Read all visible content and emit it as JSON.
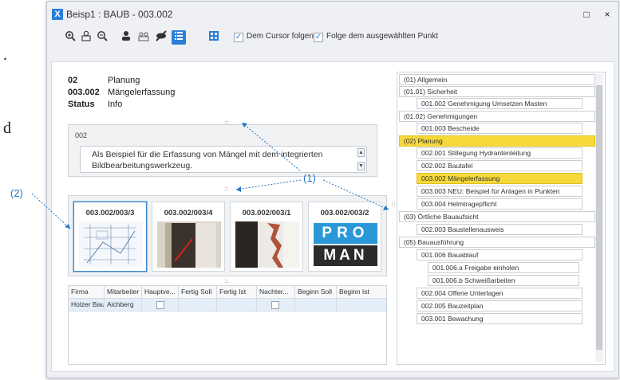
{
  "background": {
    "left_fragment_1": ".",
    "left_fragment_2": "d"
  },
  "window": {
    "icon_letter": "X",
    "title": "Beisp1 : BAUB - 003.002",
    "maximize_glyph": "□",
    "close_glyph": "×"
  },
  "toolbar": {
    "follow_cursor_label": "Dem Cursor folgen",
    "follow_point_label": "Folge dem ausgewählten Punkt"
  },
  "header": {
    "rows": [
      {
        "key": "02",
        "value": "Planung"
      },
      {
        "key": "003.002",
        "value": "Mängelerfassung"
      },
      {
        "key": "Status",
        "value": "Info"
      }
    ]
  },
  "memo": {
    "label": "002",
    "text": "Als Beispiel für die Erfassung von Mängel mit dem integrierten Bildbearbeitungswerkzeug."
  },
  "thumbnails": [
    {
      "label": "003.002/003/3",
      "kind": "sketch"
    },
    {
      "label": "003.002/003/4",
      "kind": "photo-door"
    },
    {
      "label": "003.002/003/1",
      "kind": "photo-wall"
    },
    {
      "label": "003.002/003/2",
      "kind": "logo",
      "logo_top": "PRO",
      "logo_bottom": "MAN"
    }
  ],
  "grid": {
    "columns": [
      "Firma",
      "Mitarbeiter",
      "Hauptve...",
      "Fertig Soll",
      "Fertig Ist",
      "Nachter...",
      "Beginn Soll",
      "Beginn Ist"
    ],
    "rows": [
      {
        "firma": "Holzer Bau",
        "mitarbeiter": "Aichberg"
      }
    ]
  },
  "tree": {
    "nodes": [
      {
        "label": "(01) Allgemein"
      },
      {
        "label": "(01.01) Sicherheit"
      },
      {
        "label": "001.002 Genehmigung Umsetzen Masten"
      },
      {
        "label": "(01.02) Genehmigungen"
      },
      {
        "label": "001.003 Bescheide"
      },
      {
        "label": "(02) Planung"
      },
      {
        "label": "002.001 Stillegung Hydrantenleitung"
      },
      {
        "label": "002.002 Bautafel"
      },
      {
        "label": "003.002 Mängelerfassung"
      },
      {
        "label": "003.003 NEU: Beispiel für Anlagen in Punkten"
      },
      {
        "label": "003.004 Helmtragepflicht"
      },
      {
        "label": "(03) Örtliche Bauaufsicht"
      },
      {
        "label": "002.003 Baustellenausweis"
      },
      {
        "label": "(05) Bauausführung"
      },
      {
        "label": "001.006 Bauablauf"
      },
      {
        "label": "001.006.a Freigabe einholen"
      },
      {
        "label": "001.006.b Schweißarbeiten"
      },
      {
        "label": "002.004 Offene Unterlagen"
      },
      {
        "label": "002.005 Bauzeitplan"
      },
      {
        "label": "003.001 Bewachung"
      }
    ],
    "highlight_color": "#f6d93a"
  },
  "callouts": {
    "one": "(1)",
    "two": "(2)"
  },
  "colors": {
    "accent": "#2b7fd6",
    "callout": "#1f77c8",
    "selection_row": "#e3eef9"
  }
}
